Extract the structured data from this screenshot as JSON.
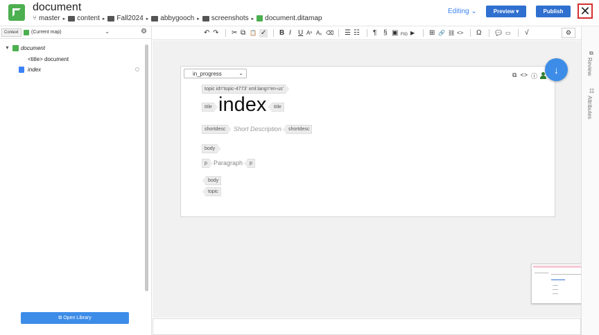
{
  "header": {
    "title": "document",
    "breadcrumb": [
      "master",
      "content",
      "Fall2024",
      "abbygooch",
      "screenshots",
      "document.ditamap"
    ],
    "mode": "Editing",
    "preview_label": "Preview",
    "publish_label": "Publish",
    "close_glyph": "✕"
  },
  "left_panel": {
    "context_label": "Context",
    "context_value": "(Current map)",
    "tree": {
      "root": "document",
      "title_node": "<title> document",
      "topic": "index"
    },
    "open_library_label": "Open Library"
  },
  "toolbar": {
    "items": [
      "↶",
      "↷",
      "✂",
      "⧉",
      "📋",
      "✓",
      "B",
      "I",
      "U",
      "Aˢ",
      "Aₓ",
      "⌫",
      "☰",
      "☷",
      "¶",
      "§",
      "▣",
      "FIG",
      "▶",
      "⊞",
      "🔗",
      "⛓",
      "<>",
      "Ω",
      "💬",
      "▭",
      "√"
    ]
  },
  "editor": {
    "status": "in_progress",
    "topic_tag": "topic id='topic-4773' xml:lang='en-us'",
    "title_tag": "title",
    "title_text": "index",
    "shortdesc_tag": "shortdesc",
    "shortdesc_text": "Short Description",
    "body_tag": "body",
    "p_tag": "p",
    "paragraph_text": "Paragraph",
    "body_end_tag": "body",
    "topic_end_tag": "topic"
  },
  "right_rail": {
    "review_label": "Review",
    "attributes_label": "Attributes"
  },
  "colors": {
    "accent": "#2f6fcf",
    "brand": "#4caf50",
    "close_border": "#d32f2f"
  }
}
